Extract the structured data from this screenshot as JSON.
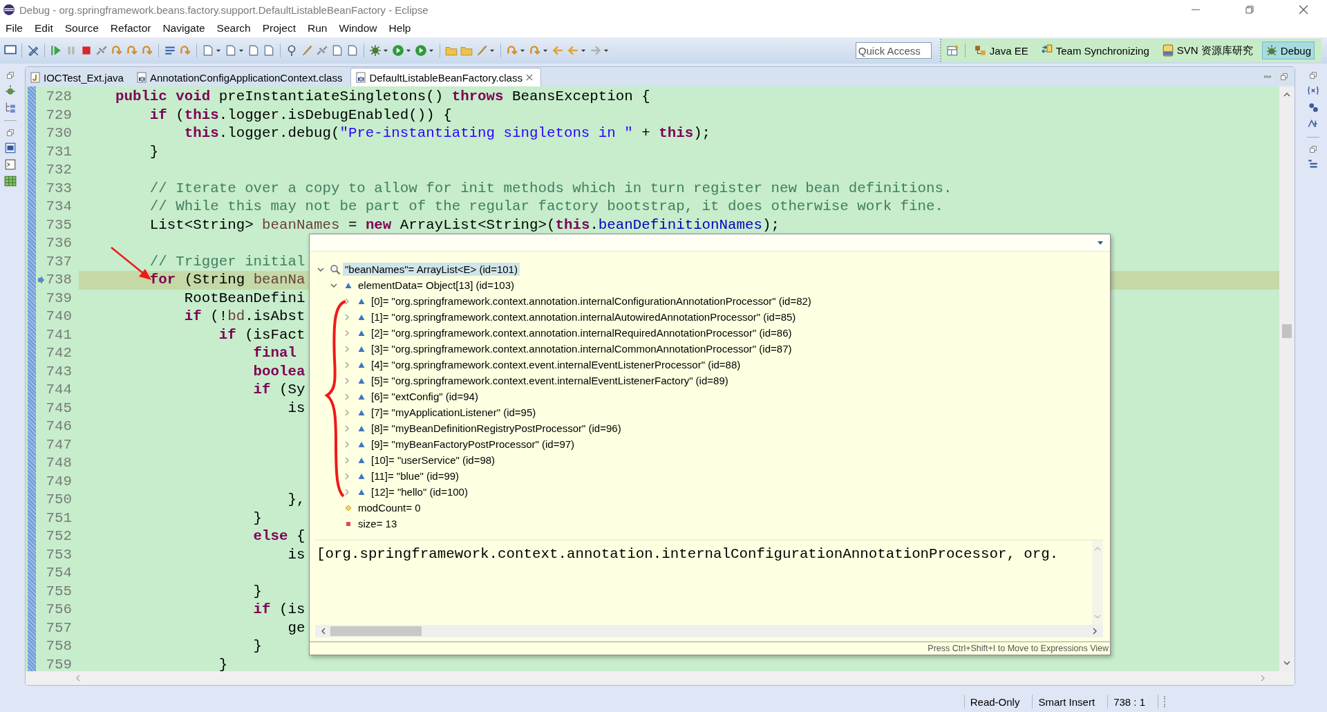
{
  "window": {
    "title": "Debug - org.springframework.beans.factory.support.DefaultListableBeanFactory - Eclipse"
  },
  "menu": [
    "File",
    "Edit",
    "Source",
    "Refactor",
    "Navigate",
    "Search",
    "Project",
    "Run",
    "Window",
    "Help"
  ],
  "quick_access": {
    "placeholder": "Quick Access"
  },
  "perspectives": [
    {
      "label": "Java EE",
      "kind": "javaee",
      "selected": false
    },
    {
      "label": "Team Synchronizing",
      "kind": "team",
      "selected": false
    },
    {
      "label": "SVN 资源库研究",
      "kind": "svn",
      "selected": false
    },
    {
      "label": "Debug",
      "kind": "debug",
      "selected": true
    }
  ],
  "editor_tabs": [
    {
      "label": "IOCTest_Ext.java",
      "kind": "java",
      "selected": false
    },
    {
      "label": "AnnotationConfigApplicationContext.class",
      "kind": "class",
      "selected": false
    },
    {
      "label": "DefaultListableBeanFactory.class",
      "kind": "class",
      "selected": true
    }
  ],
  "code": {
    "lines": [
      {
        "number": "728",
        "current": false,
        "tokens": [
          {
            "kind": "kw",
            "text": "    public void"
          },
          {
            "kind": "plain",
            "text": " preInstantiateSingletons() "
          },
          {
            "kind": "kw",
            "text": "throws"
          },
          {
            "kind": "plain",
            "text": " BeansException {"
          }
        ]
      },
      {
        "number": "729",
        "current": false,
        "tokens": [
          {
            "kind": "kw",
            "text": "        if"
          },
          {
            "kind": "plain",
            "text": " ("
          },
          {
            "kind": "kw",
            "text": "this"
          },
          {
            "kind": "plain",
            "text": ".logger.isDebugEnabled()) {"
          }
        ]
      },
      {
        "number": "730",
        "current": false,
        "tokens": [
          {
            "kind": "kw",
            "text": "            this"
          },
          {
            "kind": "plain",
            "text": ".logger.debug("
          },
          {
            "kind": "str",
            "text": "\"Pre-instantiating singletons in \""
          },
          {
            "kind": "plain",
            "text": " + "
          },
          {
            "kind": "kw",
            "text": "this"
          },
          {
            "kind": "plain",
            "text": ");"
          }
        ]
      },
      {
        "number": "731",
        "current": false,
        "tokens": [
          {
            "kind": "plain",
            "text": "        }"
          }
        ]
      },
      {
        "number": "732",
        "current": false
      },
      {
        "number": "733",
        "current": false,
        "tokens": [
          {
            "kind": "cm",
            "text": "        // Iterate over a copy to allow for init methods which in turn register new bean definitions."
          }
        ]
      },
      {
        "number": "734",
        "current": false,
        "tokens": [
          {
            "kind": "cm",
            "text": "        // While this may not be part of the regular factory bootstrap, it does otherwise work fine."
          }
        ]
      },
      {
        "number": "735",
        "current": false,
        "tokens": [
          {
            "kind": "plain",
            "text": "        List<String> "
          },
          {
            "kind": "var",
            "text": "beanNames"
          },
          {
            "kind": "plain",
            "text": " = "
          },
          {
            "kind": "kw",
            "text": "new"
          },
          {
            "kind": "plain",
            "text": " ArrayList<String>("
          },
          {
            "kind": "kw",
            "text": "this"
          },
          {
            "kind": "plain",
            "text": "."
          },
          {
            "kind": "field",
            "text": "beanDefinitionNames"
          },
          {
            "kind": "plain",
            "text": ");"
          }
        ]
      },
      {
        "number": "736",
        "current": false
      },
      {
        "number": "737",
        "current": false,
        "tokens": [
          {
            "kind": "cm",
            "text": "        // Trigger initial"
          }
        ]
      },
      {
        "number": "738",
        "current": true,
        "tokens": [
          {
            "kind": "kw",
            "text": "        for"
          },
          {
            "kind": "plain",
            "text": " (String "
          },
          {
            "kind": "var",
            "text": "beanNa"
          }
        ]
      },
      {
        "number": "739",
        "current": false,
        "tokens": [
          {
            "kind": "plain",
            "text": "            RootBeanDefini"
          }
        ]
      },
      {
        "number": "740",
        "current": false,
        "tokens": [
          {
            "kind": "kw",
            "text": "            if"
          },
          {
            "kind": "plain",
            "text": " (!"
          },
          {
            "kind": "var",
            "text": "bd"
          },
          {
            "kind": "plain",
            "text": ".isAbst"
          }
        ]
      },
      {
        "number": "741",
        "current": false,
        "tokens": [
          {
            "kind": "kw",
            "text": "                if"
          },
          {
            "kind": "plain",
            "text": " (isFact"
          }
        ]
      },
      {
        "number": "742",
        "current": false,
        "tokens": [
          {
            "kind": "kw",
            "text": "                    final"
          }
        ]
      },
      {
        "number": "743",
        "current": false,
        "tokens": [
          {
            "kind": "kw",
            "text": "                    boolea"
          }
        ]
      },
      {
        "number": "744",
        "current": false,
        "tokens": [
          {
            "kind": "kw",
            "text": "                    if"
          },
          {
            "kind": "plain",
            "text": " (Sy"
          }
        ]
      },
      {
        "number": "745",
        "current": false,
        "tokens": [
          {
            "kind": "plain",
            "text": "                        is"
          }
        ]
      },
      {
        "number": "746",
        "current": false
      },
      {
        "number": "747",
        "current": false
      },
      {
        "number": "748",
        "current": false
      },
      {
        "number": "749",
        "current": false
      },
      {
        "number": "750",
        "current": false,
        "tokens": [
          {
            "kind": "plain",
            "text": "                        },"
          }
        ]
      },
      {
        "number": "751",
        "current": false,
        "tokens": [
          {
            "kind": "plain",
            "text": "                    }"
          }
        ]
      },
      {
        "number": "752",
        "current": false,
        "tokens": [
          {
            "kind": "kw",
            "text": "                    else"
          },
          {
            "kind": "plain",
            "text": " {"
          }
        ]
      },
      {
        "number": "753",
        "current": false,
        "tokens": [
          {
            "kind": "plain",
            "text": "                        is"
          }
        ]
      },
      {
        "number": "754",
        "current": false
      },
      {
        "number": "755",
        "current": false,
        "tokens": [
          {
            "kind": "plain",
            "text": "                    }"
          }
        ]
      },
      {
        "number": "756",
        "current": false,
        "tokens": [
          {
            "kind": "kw",
            "text": "                    if"
          },
          {
            "kind": "plain",
            "text": " (is"
          }
        ]
      },
      {
        "number": "757",
        "current": false,
        "tokens": [
          {
            "kind": "plain",
            "text": "                        ge"
          }
        ]
      },
      {
        "number": "758",
        "current": false,
        "tokens": [
          {
            "kind": "plain",
            "text": "                    }"
          }
        ]
      },
      {
        "number": "759",
        "current": false,
        "tokens": [
          {
            "kind": "plain",
            "text": "                }"
          }
        ]
      }
    ]
  },
  "inspect_popup": {
    "tree": [
      {
        "label": "\"beanNames\"= ArrayList<E>  (id=101)",
        "kind": "search",
        "selected": true,
        "expanded": true,
        "children": [
          {
            "label": "elementData= Object[13]  (id=103)",
            "kind": "field",
            "selected": false,
            "expanded": true,
            "children": [
              {
                "label": "[0]= \"org.springframework.context.annotation.internalConfigurationAnnotationProcessor\" (id=82)",
                "kind": "field",
                "selected": false,
                "expanded": false
              },
              {
                "label": "[1]= \"org.springframework.context.annotation.internalAutowiredAnnotationProcessor\" (id=85)",
                "kind": "field",
                "selected": false,
                "expanded": false
              },
              {
                "label": "[2]= \"org.springframework.context.annotation.internalRequiredAnnotationProcessor\" (id=86)",
                "kind": "field",
                "selected": false,
                "expanded": false
              },
              {
                "label": "[3]= \"org.springframework.context.annotation.internalCommonAnnotationProcessor\" (id=87)",
                "kind": "field",
                "selected": false,
                "expanded": false
              },
              {
                "label": "[4]= \"org.springframework.context.event.internalEventListenerProcessor\" (id=88)",
                "kind": "field",
                "selected": false,
                "expanded": false
              },
              {
                "label": "[5]= \"org.springframework.context.event.internalEventListenerFactory\" (id=89)",
                "kind": "field",
                "selected": false,
                "expanded": false
              },
              {
                "label": "[6]= \"extConfig\" (id=94)",
                "kind": "field",
                "selected": false,
                "expanded": false
              },
              {
                "label": "[7]= \"myApplicationListener\" (id=95)",
                "kind": "field",
                "selected": false,
                "expanded": false
              },
              {
                "label": "[8]= \"myBeanDefinitionRegistryPostProcessor\" (id=96)",
                "kind": "field",
                "selected": false,
                "expanded": false
              },
              {
                "label": "[9]= \"myBeanFactoryPostProcessor\" (id=97)",
                "kind": "field",
                "selected": false,
                "expanded": false
              },
              {
                "label": "[10]= \"userService\" (id=98)",
                "kind": "field",
                "selected": false,
                "expanded": false
              },
              {
                "label": "[11]= \"blue\" (id=99)",
                "kind": "field",
                "selected": false,
                "expanded": false
              },
              {
                "label": "[12]= \"hello\" (id=100)",
                "kind": "field",
                "selected": false,
                "expanded": false
              }
            ]
          },
          {
            "label": "modCount= 0",
            "kind": "protected",
            "selected": false
          },
          {
            "label": "size= 13",
            "kind": "private",
            "selected": false
          }
        ]
      }
    ],
    "detail": "[org.springframework.context.annotation.internalConfigurationAnnotationProcessor, org.",
    "hint": "Press Ctrl+Shift+I to Move to Expressions View"
  },
  "status_bar": [
    "Read-Only",
    "Smart Insert",
    "738 : 1"
  ]
}
